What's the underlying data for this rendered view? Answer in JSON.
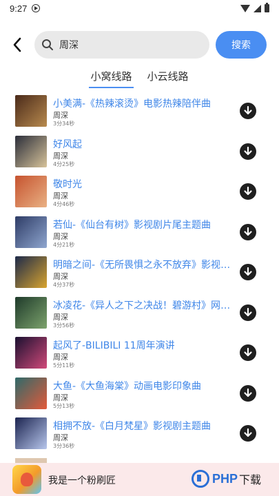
{
  "status": {
    "time": "9:27"
  },
  "search": {
    "query": "周深",
    "button_label": "搜索"
  },
  "tabs": [
    {
      "label": "小窝线路",
      "active": true
    },
    {
      "label": "小云线路",
      "active": false
    }
  ],
  "songs": [
    {
      "title": "小美满-《热辣滚烫》电影热辣陪伴曲",
      "artist": "周深",
      "duration": "3分34秒",
      "cover": [
        "#4a2a1a",
        "#b88a4e"
      ]
    },
    {
      "title": "好风起",
      "artist": "周深",
      "duration": "4分25秒",
      "cover": [
        "#2b2e3a",
        "#d7c39a"
      ]
    },
    {
      "title": "敬时光",
      "artist": "周深",
      "duration": "4分46秒",
      "cover": [
        "#c6532f",
        "#e9b184"
      ]
    },
    {
      "title": "若仙-《仙台有树》影视剧片尾主题曲",
      "artist": "周深",
      "duration": "4分21秒",
      "cover": [
        "#2e3c66",
        "#8fa6cf"
      ]
    },
    {
      "title": "明暗之间-《无所畏惧之永不放弃》影视剧主...",
      "artist": "周深",
      "duration": "4分37秒",
      "cover": [
        "#1d2a4a",
        "#d8a42f"
      ]
    },
    {
      "title": "冰凌花-《异人之下之决战！碧游村》网络剧...",
      "artist": "周深",
      "duration": "3分56秒",
      "cover": [
        "#1e3a2a",
        "#7da36d"
      ]
    },
    {
      "title": "起风了-BILIBILI 11周年演讲",
      "artist": "周深",
      "duration": "5分11秒",
      "cover": [
        "#1a1030",
        "#d14a7a"
      ]
    },
    {
      "title": "大鱼-《大鱼海棠》动画电影印象曲",
      "artist": "周深",
      "duration": "5分13秒",
      "cover": [
        "#2f6a6a",
        "#e35a3a"
      ]
    },
    {
      "title": "相拥不放-《白月梵星》影视剧主题曲",
      "artist": "周深",
      "duration": "3分36秒",
      "cover": [
        "#1c2450",
        "#b7c6ec"
      ]
    }
  ],
  "ad": {
    "text": "我是一个粉刷匠",
    "brand": "PHP",
    "brand_suffix": "下载"
  },
  "colors": {
    "accent": "#4a8ef2",
    "title_text": "#3f86e8",
    "ad_background": "#fbe9ea"
  }
}
